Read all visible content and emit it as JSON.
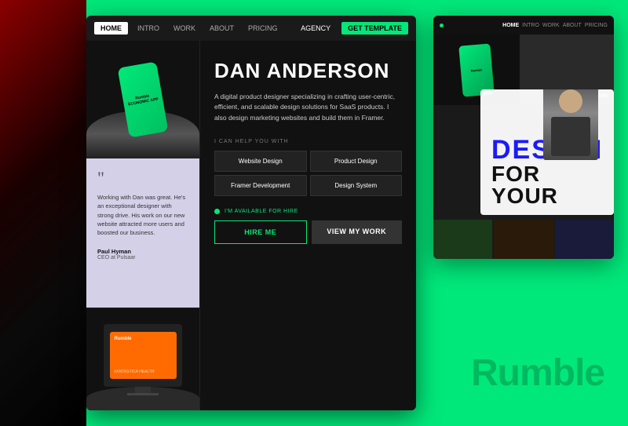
{
  "background_color": "#00e87a",
  "nav": {
    "home_label": "HOME",
    "intro_label": "INTRO",
    "work_label": "WORK",
    "about_label": "ABOUT",
    "pricing_label": "PRICING",
    "agency_label": "AGENCY",
    "template_label": "GET TEMPLATE"
  },
  "hero": {
    "name": "DAN ANDERSON",
    "description": "A digital product designer specializing in crafting user-centric, efficient, and scalable design solutions for SaaS products. I also design marketing websites and build them in Framer.",
    "services_label": "I CAN HELP YOU WITH",
    "services": [
      {
        "label": "Website Design"
      },
      {
        "label": "Product Design"
      },
      {
        "label": "Framer Development"
      },
      {
        "label": "Design System"
      }
    ],
    "available_label": "I'M AVAILABLE FOR HIRE",
    "hire_label": "HIRE ME",
    "work_label": "VIEW MY WORK"
  },
  "testimonial": {
    "quote_mark": "99",
    "text": "Working with Dan was great. He's an exceptional designer with strong drive. His work on our new website attracted more users and boosted our business.",
    "author_name": "Paul Hyman",
    "author_title": "CEO at Pulsaar"
  },
  "phone_card": {
    "brand": "Rumble",
    "sub_text": "ECONOMIC APP"
  },
  "monitor_card": {
    "brand": "Rumble",
    "sub_text": "FANTASTICA HEALTH"
  },
  "second_window": {
    "nav": {
      "home": "HOME",
      "intro": "INTRO",
      "work": "WORK",
      "about": "ABOUT",
      "pricing": "PRICING"
    },
    "design_text": "DESIGN",
    "for_text": "FOR YOUR",
    "rumble_logo": "Rumble"
  },
  "brand": {
    "name": "Rumble"
  }
}
